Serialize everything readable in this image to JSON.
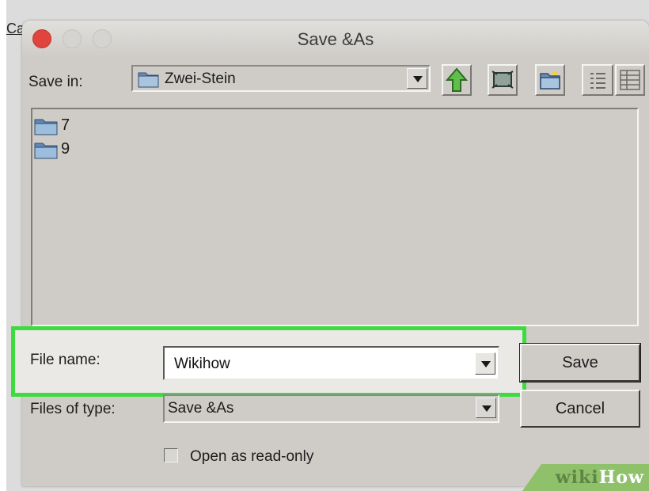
{
  "background": {
    "menu_fragment": "Ca"
  },
  "dialog": {
    "title": "Save &As",
    "save_in_label": "Save in:",
    "save_in_value": "Zwei-Stein",
    "toolbar": [
      {
        "name": "up-folder-icon"
      },
      {
        "name": "desktop-icon"
      },
      {
        "name": "new-folder-icon"
      },
      {
        "name": "list-view-icon"
      },
      {
        "name": "details-view-icon"
      }
    ],
    "files": [
      "7",
      "9"
    ],
    "file_name_label": "File name:",
    "file_name_value": "Wikihow",
    "files_of_type_label": "Files of type:",
    "files_of_type_value": "Save &As",
    "save_button": "Save",
    "cancel_button": "Cancel",
    "read_only_label": "Open as read-only"
  },
  "highlight_color": "#3ddb3f",
  "watermark": {
    "part1": "wiki",
    "part2": "How"
  }
}
